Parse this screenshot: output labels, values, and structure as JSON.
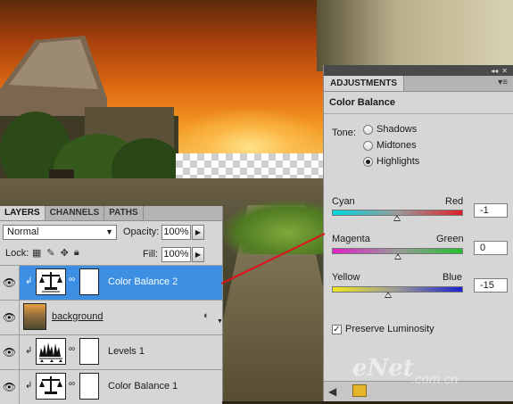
{
  "adjustments": {
    "tab": "ADJUSTMENTS",
    "title": "Color Balance",
    "tone_label": "Tone:",
    "tones": [
      {
        "label": "Shadows",
        "selected": false
      },
      {
        "label": "Midtones",
        "selected": false
      },
      {
        "label": "Highlights",
        "selected": true
      }
    ],
    "sliders": [
      {
        "left": "Cyan",
        "right": "Red",
        "value": "-1",
        "position": -1,
        "colors": [
          "#00d8e0",
          "#e0202a"
        ]
      },
      {
        "left": "Magenta",
        "right": "Green",
        "value": "0",
        "position": 0,
        "colors": [
          "#e020c8",
          "#22c030"
        ]
      },
      {
        "left": "Yellow",
        "right": "Blue",
        "value": "-15",
        "position": -15,
        "colors": [
          "#f0e81c",
          "#1820d0"
        ]
      }
    ],
    "preserve_luminosity": {
      "label": "Preserve Luminosity",
      "checked": true
    }
  },
  "layers_panel": {
    "tabs": [
      "LAYERS",
      "CHANNELS",
      "PATHS"
    ],
    "blend_mode": "Normal",
    "opacity_label": "Opacity:",
    "opacity": "100%",
    "lock_label": "Lock:",
    "fill_label": "Fill:",
    "fill": "100%",
    "layers": [
      {
        "name": "Color Balance 2",
        "type": "color-balance",
        "selected": true
      },
      {
        "name": "background",
        "type": "smart-object",
        "selected": false
      },
      {
        "name": "Levels 1",
        "type": "levels",
        "selected": false
      },
      {
        "name": "Color Balance 1",
        "type": "color-balance",
        "selected": false
      }
    ]
  },
  "watermark": {
    "brand": "eNet",
    "domain": ".com.cn"
  },
  "accent_color": "#3c8fe2",
  "annotation_color": "#e0101c"
}
